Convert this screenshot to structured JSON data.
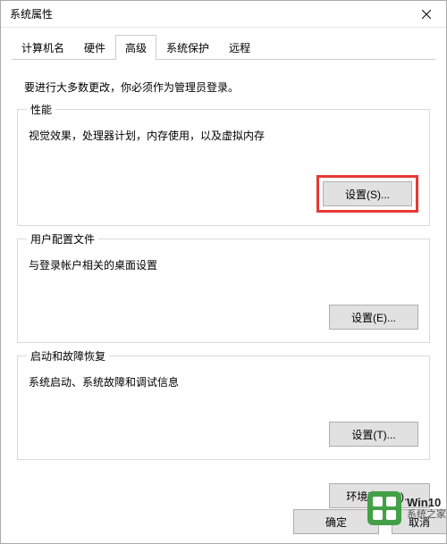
{
  "window": {
    "title": "系统属性"
  },
  "tabs": {
    "items": [
      {
        "label": "计算机名"
      },
      {
        "label": "硬件"
      },
      {
        "label": "高级"
      },
      {
        "label": "系统保护"
      },
      {
        "label": "远程"
      }
    ],
    "active_index": 2
  },
  "intro": "要进行大多数更改，你必须作为管理员登录。",
  "groups": {
    "performance": {
      "title": "性能",
      "desc": "视觉效果，处理器计划，内存使用，以及虚拟内存",
      "button": "设置(S)..."
    },
    "profiles": {
      "title": "用户配置文件",
      "desc": "与登录帐户相关的桌面设置",
      "button": "设置(E)..."
    },
    "startup": {
      "title": "启动和故障恢复",
      "desc": "系统启动、系统故障和调试信息",
      "button": "设置(T)..."
    }
  },
  "env_button": "环境变量(N)...",
  "footer": {
    "ok": "确定",
    "cancel": "取消"
  },
  "watermark": {
    "line1": "Win10",
    "line2": "系统之家"
  },
  "highlight_color": "#e53935"
}
